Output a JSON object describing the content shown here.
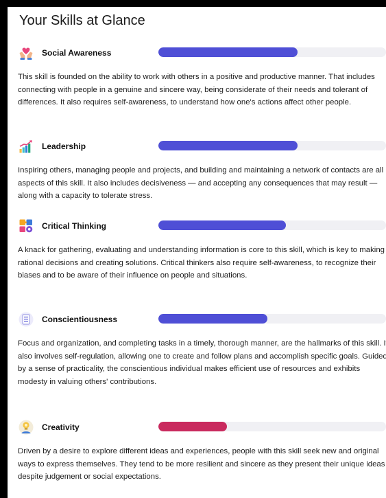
{
  "page": {
    "title": "Your Skills at Glance"
  },
  "colors": {
    "bar_track": "#f0f0f4",
    "bar_primary": "#4f4fd6",
    "bar_low": "#c92a5e"
  },
  "skills": [
    {
      "name": "Social Awareness",
      "icon": "heart-hands-icon",
      "level_percent": 61,
      "bar_color": "#4f4fd6",
      "description": "This skill is founded on the ability to work with others in a positive and productive manner. That includes connecting with people in a genuine and sincere way, being considerate of their needs and tolerant of differences. It also requires self-awareness, to understand how one's actions affect other people."
    },
    {
      "name": "Leadership",
      "icon": "growth-chart-icon",
      "level_percent": 61,
      "bar_color": "#4f4fd6",
      "description": "Inspiring others, managing people and projects, and building and maintaining a network of contacts are all aspects of this skill. It also includes decisiveness — and accepting any consequences that may result — along with a capacity to tolerate stress."
    },
    {
      "name": "Critical Thinking",
      "icon": "puzzle-gear-icon",
      "level_percent": 56,
      "bar_color": "#4f4fd6",
      "description": "A knack for gathering, evaluating and understanding information is core to this skill, which is key to making rational decisions and creating solutions. Critical thinkers also require self-awareness, to recognize their biases and to be aware of their influence on people and situations."
    },
    {
      "name": "Conscientiousness",
      "icon": "checklist-icon",
      "level_percent": 48,
      "bar_color": "#4f4fd6",
      "description": "Focus and organization, and completing tasks in a timely, thorough manner, are the hallmarks of this skill. It also involves self-regulation, allowing one to create and follow plans and accomplish specific goals. Guided by a sense of practicality, the conscientious individual makes efficient use of resources and exhibits modesty in valuing others' contributions."
    },
    {
      "name": "Creativity",
      "icon": "lightbulb-person-icon",
      "level_percent": 30,
      "bar_color": "#c92a5e",
      "description": "Driven by a desire to explore different ideas and experiences, people with this skill seek new and original ways to express themselves. They tend to be more resilient and sincere as they present their unique ideas despite judgement or social expectations."
    }
  ]
}
